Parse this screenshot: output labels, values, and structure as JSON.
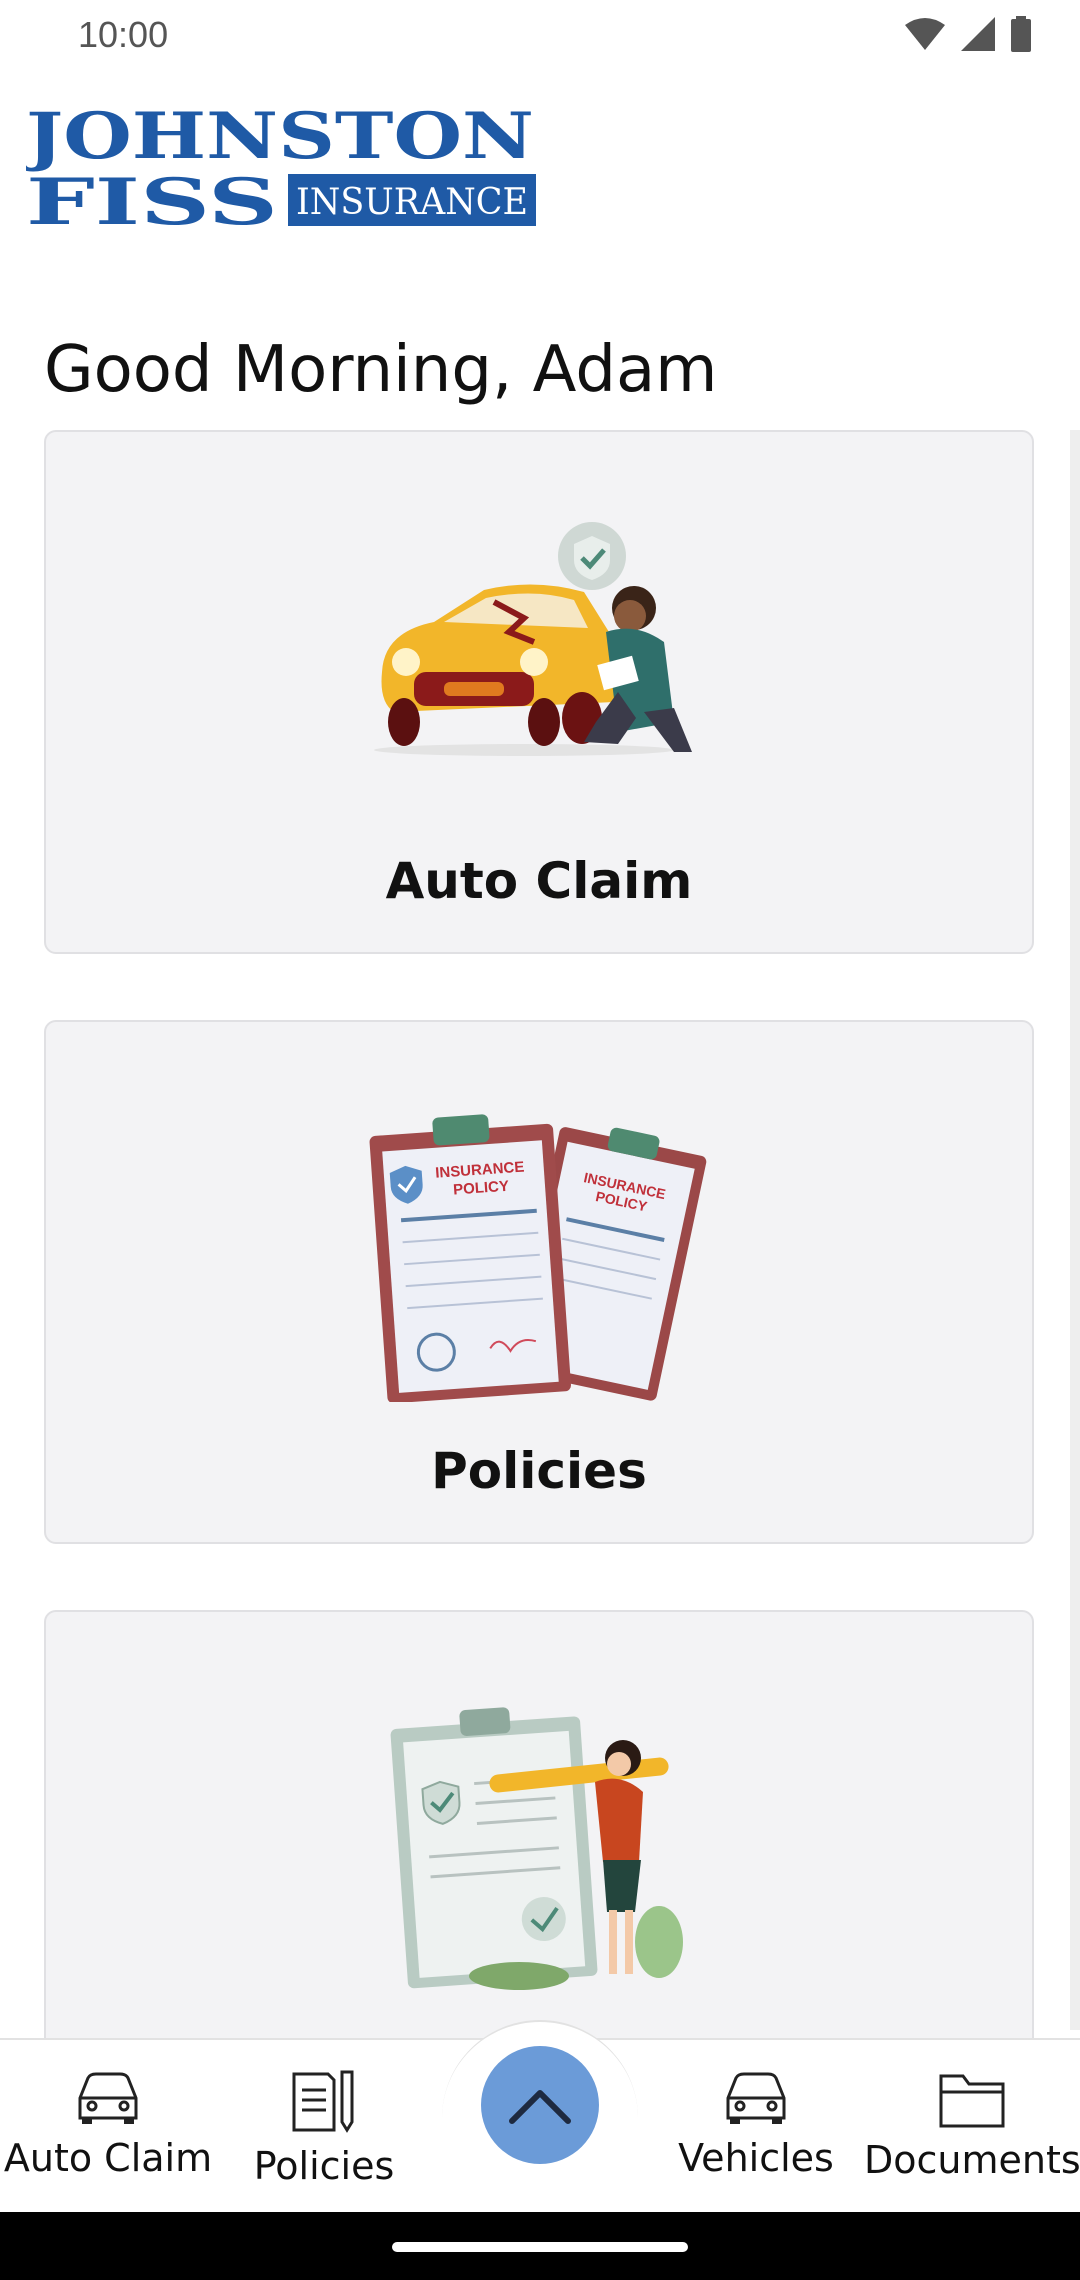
{
  "status_bar": {
    "time": "10:00"
  },
  "logo": {
    "line1": "JOHNSTON",
    "line2": "FISS",
    "badge": "INSURANCE",
    "color": "#1f5aa6"
  },
  "greeting": "Good Morning, Adam",
  "cards": [
    {
      "label": "Auto Claim",
      "illustration": "car-damage-inspection"
    },
    {
      "label": "Policies",
      "illustration": "insurance-policy-clipboards",
      "doc_text": "INSURANCE POLICY"
    },
    {
      "label": "",
      "illustration": "checklist-woman-pencil"
    }
  ],
  "bottom_nav": {
    "items": [
      {
        "label": "Auto Claim",
        "icon": "car-icon"
      },
      {
        "label": "Policies",
        "icon": "document-pen-icon"
      },
      {
        "label": "Vehicles",
        "icon": "car-icon"
      },
      {
        "label": "Documents",
        "icon": "folder-icon"
      }
    ],
    "fab_icon": "chevron-up-icon"
  },
  "colors": {
    "accent": "#6b9bd8",
    "card_bg": "#f3f3f5",
    "brand": "#1f5aa6"
  }
}
